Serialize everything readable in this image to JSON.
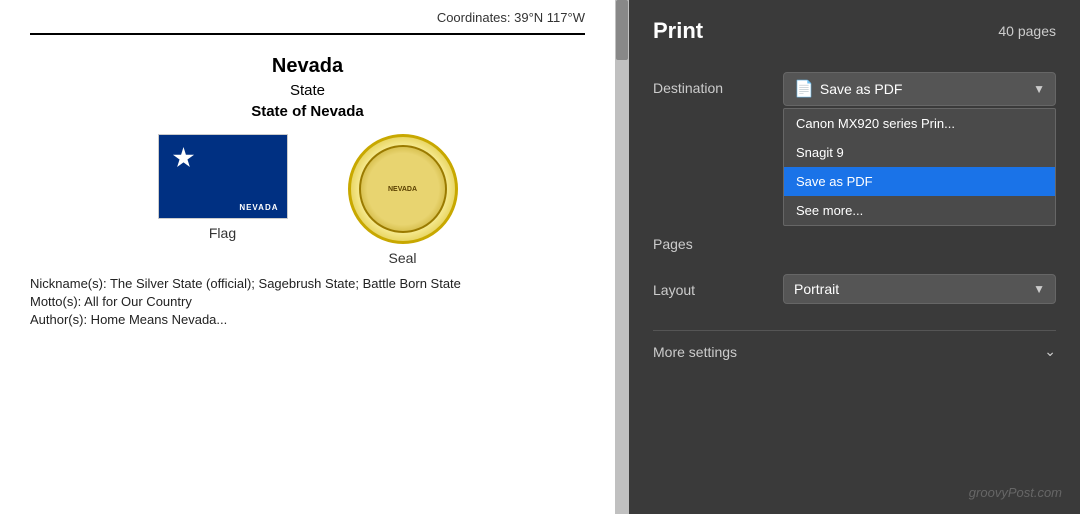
{
  "document": {
    "coordinates": "Coordinates: 39°N 117°W",
    "title": "Nevada",
    "subtitle": "State",
    "state_of": "State of Nevada",
    "flag_label": "Flag",
    "seal_label": "Seal",
    "nickname": "Nickname(s): The Silver State (official); Sagebrush State; Battle Born State",
    "motto": "Motto(s): All for Our Country",
    "author_partial": "Author(s): Home Means Nevada..."
  },
  "print_panel": {
    "title": "Print",
    "pages_label": "40 pages",
    "destination_label": "Destination",
    "destination_value": "Save as PDF",
    "pages_row_label": "Pages",
    "layout_label": "Layout",
    "layout_value": "Portrait",
    "more_settings_label": "More settings",
    "dropdown_items": [
      {
        "id": "canon",
        "label": "Canon MX920 series Prin..."
      },
      {
        "id": "snagit",
        "label": "Snagit 9"
      },
      {
        "id": "save_pdf",
        "label": "Save as PDF",
        "selected": true
      },
      {
        "id": "see_more",
        "label": "See more..."
      }
    ]
  },
  "watermark": "groovyPost.com"
}
